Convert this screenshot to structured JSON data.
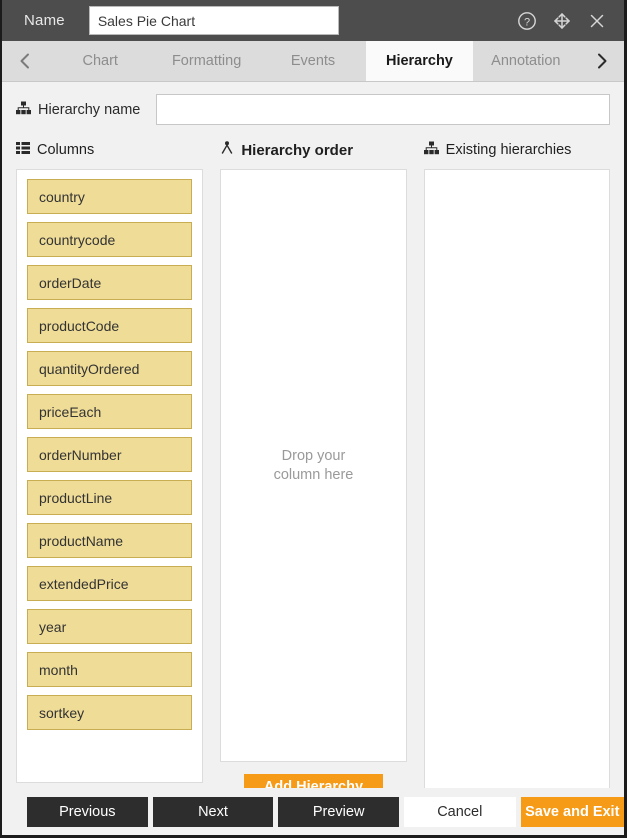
{
  "titlebar": {
    "name_label": "Name",
    "chart_name_value": "Sales Pie Chart",
    "chart_name_placeholder": "",
    "icons": {
      "help": "help-circle-icon",
      "move": "move-icon",
      "close": "close-icon"
    }
  },
  "tabstrip": {
    "prev_arrow": "chevron-left-icon",
    "next_arrow": "chevron-right-icon",
    "tabs": [
      {
        "label": "Chart",
        "active": false
      },
      {
        "label": "Formatting",
        "active": false
      },
      {
        "label": "Events",
        "active": false
      },
      {
        "label": "Hierarchy",
        "active": true
      },
      {
        "label": "Annotation",
        "active": false
      }
    ]
  },
  "hierarchy_name": {
    "label": "Hierarchy name",
    "icon": "hierarchy-icon",
    "value": "",
    "placeholder": ""
  },
  "columns_panel": {
    "title": "Columns",
    "icon": "list-icon",
    "items": [
      "country",
      "countrycode",
      "orderDate",
      "productCode",
      "quantityOrdered",
      "priceEach",
      "orderNumber",
      "productLine",
      "productName",
      "extendedPrice",
      "year",
      "month",
      "sortkey"
    ]
  },
  "hierarchy_order_panel": {
    "title": "Hierarchy order",
    "icon": "hierarchy-branch-icon",
    "drop_text_line1": "Drop your",
    "drop_text_line2": "column here",
    "add_button_label": "Add Hierarchy"
  },
  "existing_panel": {
    "title": "Existing hierarchies",
    "icon": "hierarchy-icon",
    "items": []
  },
  "footer": {
    "previous_label": "Previous",
    "next_label": "Next",
    "preview_label": "Preview",
    "cancel_label": "Cancel",
    "save_exit_label": "Save and Exit"
  },
  "colors": {
    "accent_orange": "#f59b18",
    "chip_fill": "#efdc97",
    "chip_border": "#c9ad52",
    "titlebar_bg": "#4d4d4d",
    "tabstrip_bg": "#dcdcdc",
    "panel_bg": "#f1f1f1",
    "button_dark": "#2d2d2d"
  }
}
